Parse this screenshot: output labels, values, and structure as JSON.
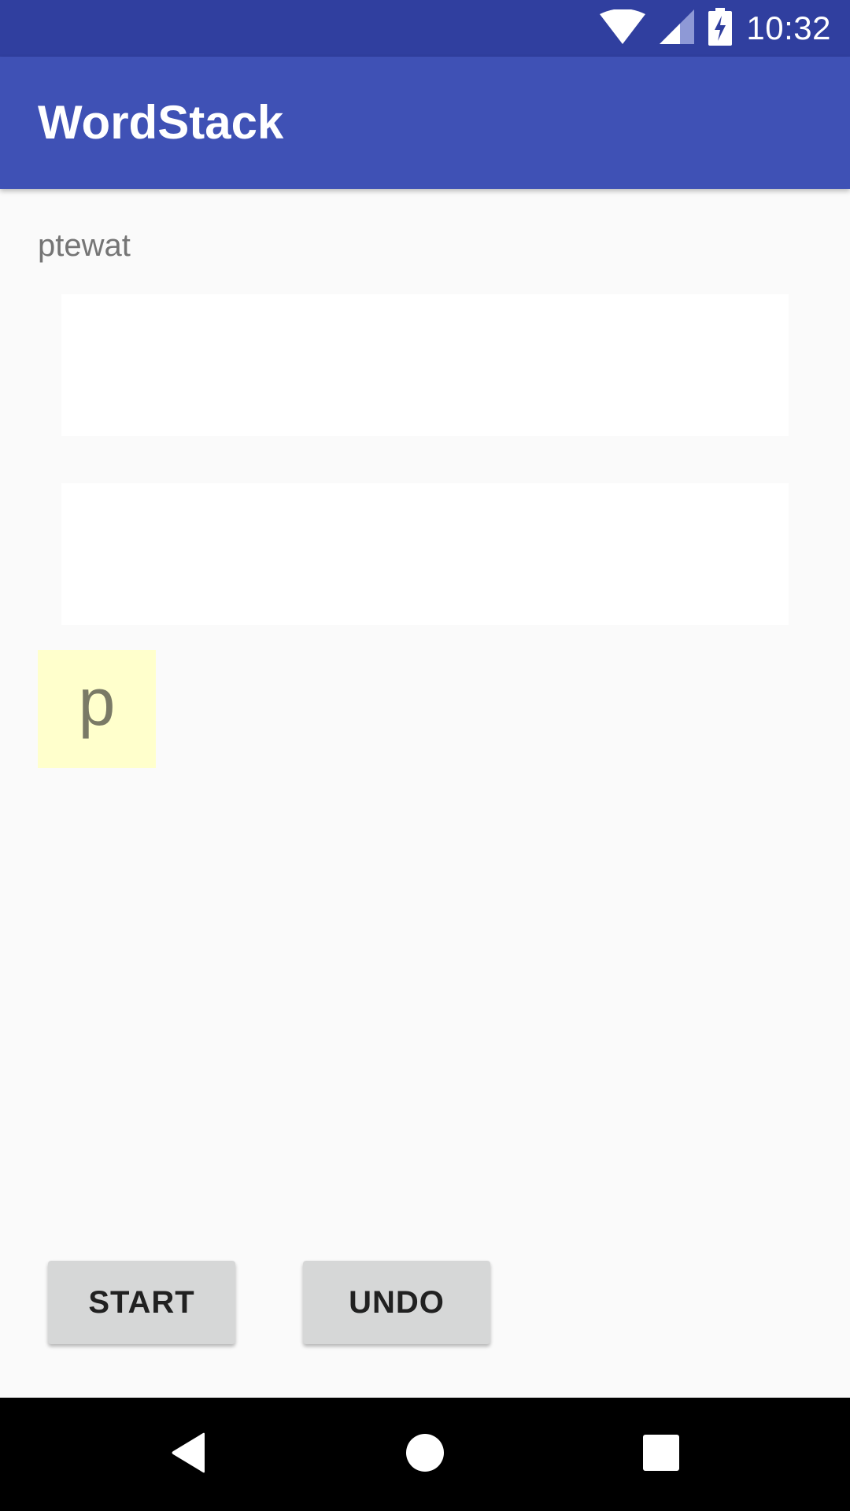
{
  "status_bar": {
    "time": "10:32",
    "icons": [
      "wifi-icon",
      "cell-signal-icon",
      "battery-charging-icon"
    ]
  },
  "app_bar": {
    "title": "WordStack"
  },
  "game": {
    "scrambled_word": "ptewat",
    "current_letter": "p"
  },
  "buttons": {
    "start_label": "START",
    "undo_label": "UNDO"
  },
  "nav_bar": {
    "icons": [
      "back-icon",
      "home-icon",
      "recents-icon"
    ]
  },
  "colors": {
    "status_bar": "#303f9f",
    "app_bar": "#3f51b5",
    "background": "#fafafa",
    "tile": "#ffffcc",
    "button": "#d6d7d7"
  }
}
